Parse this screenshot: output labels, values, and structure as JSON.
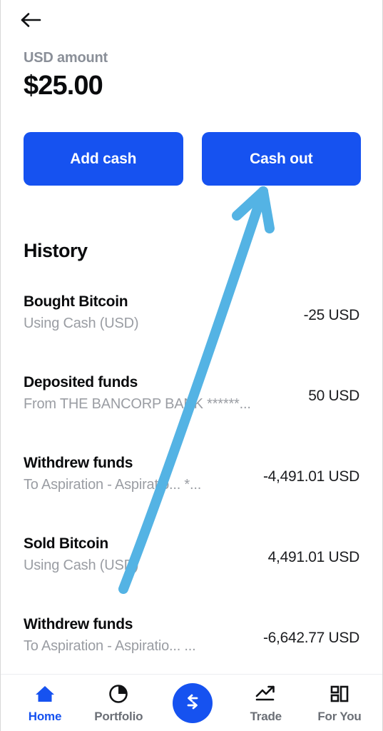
{
  "header": {
    "back_icon": "arrow-left-icon"
  },
  "balance": {
    "label": "USD amount",
    "value": "$25.00"
  },
  "actions": {
    "add_cash_label": "Add cash",
    "cash_out_label": "Cash out",
    "button_color": "#1652f0"
  },
  "history": {
    "title": "History",
    "rows": [
      {
        "title": "Bought Bitcoin",
        "subtitle": "Using Cash (USD)",
        "amount": "-25 USD"
      },
      {
        "title": "Deposited funds",
        "subtitle": "From THE BANCORP BANK ******...",
        "amount": "50 USD"
      },
      {
        "title": "Withdrew funds",
        "subtitle": "To Aspiration - Aspiratio... *...",
        "amount": "-4,491.01 USD"
      },
      {
        "title": "Sold Bitcoin",
        "subtitle": "Using Cash (USD)",
        "amount": "4,491.01 USD"
      },
      {
        "title": "Withdrew funds",
        "subtitle": "To Aspiration - Aspiratio... ...",
        "amount": "-6,642.77 USD"
      }
    ]
  },
  "annotation": {
    "type": "arrow",
    "color": "#54b3e4",
    "points_to": "Cash out"
  },
  "bottom_nav": {
    "items": [
      {
        "label": "Home",
        "icon": "home-icon",
        "active": true
      },
      {
        "label": "Portfolio",
        "icon": "pie-chart-icon",
        "active": false
      },
      {
        "label": "Trade",
        "icon": "trending-up-icon",
        "active": false
      },
      {
        "label": "For You",
        "icon": "grid-blocks-icon",
        "active": false
      }
    ],
    "fab_icon": "swap-arrows-icon",
    "fab_color": "#1652f0",
    "active_color": "#1652f0"
  }
}
